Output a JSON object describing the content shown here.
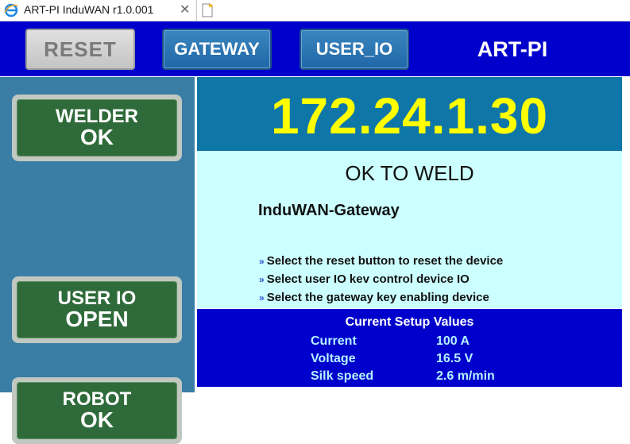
{
  "window": {
    "tab_title": "ART-PI InduWAN r1.0.001",
    "close_glyph": "✕"
  },
  "header": {
    "reset_label": "RESET",
    "gateway_label": "GATEWAY",
    "userio_label": "USER_IO",
    "brand": "ART-PI"
  },
  "statuses": [
    {
      "line1": "WELDER",
      "line2": "OK"
    },
    {
      "line1": "USER IO",
      "line2": "OPEN"
    },
    {
      "line1": "ROBOT",
      "line2": "OK"
    }
  ],
  "main": {
    "ip_address": "172.24.1.30",
    "state": "OK TO WELD",
    "device_name": "InduWAN-Gateway",
    "instructions": [
      "Select the reset button to reset the device",
      "Select user  IO kev control device IO",
      "Select the gateway key enabling device"
    ],
    "arrow_glyph": "»"
  },
  "setup": {
    "title": "Current Setup Values",
    "rows": [
      {
        "label": "Current",
        "value": "100 A"
      },
      {
        "label": "Voltage",
        "value": "16.5 V"
      },
      {
        "label": "Silk speed",
        "value": "2.6 m/min"
      }
    ]
  },
  "colors": {
    "header_bg": "#0000cc",
    "left_panel_bg": "#3a7ea6",
    "ip_bg": "#0f76a8",
    "ip_text": "#ffff00",
    "info_bg": "#ccffff",
    "status_green": "#2f6b3a",
    "setup_text": "#b4f1ff"
  },
  "icons": {
    "tab_icon": "ie-browser-icon",
    "new_tab": "new-tab-icon"
  }
}
